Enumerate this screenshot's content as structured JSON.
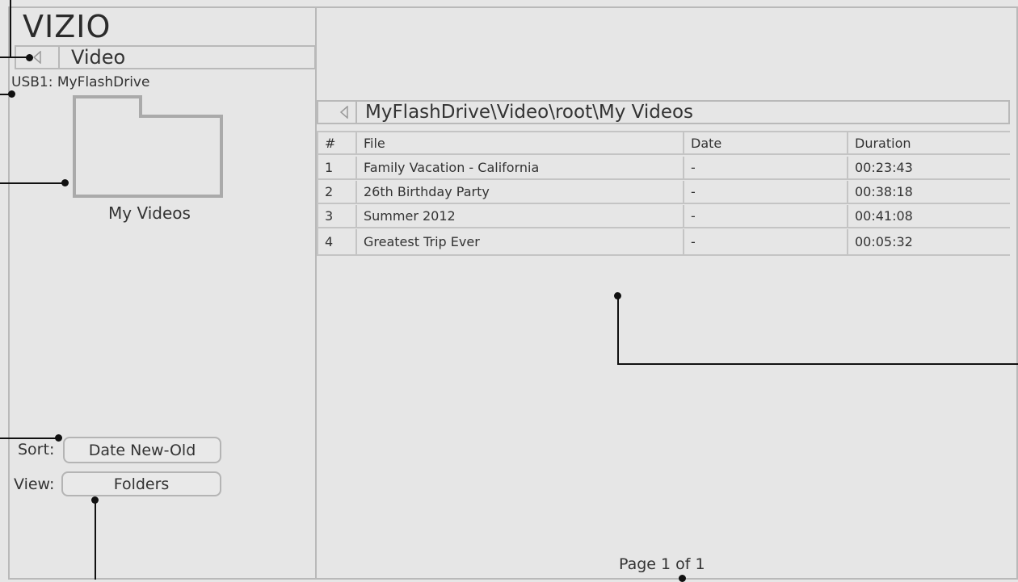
{
  "brand": {
    "logo_text": "VIZIO"
  },
  "sidebar": {
    "back_icon": "left-triangle-icon",
    "section_title": "Video",
    "source_label": "USB1: MyFlashDrive",
    "folder": {
      "icon": "folder-icon",
      "label": "My Videos"
    },
    "sort": {
      "label": "Sort:",
      "value": "Date New-Old"
    },
    "view": {
      "label": "View:",
      "value": "Folders"
    }
  },
  "main": {
    "back_icon": "left-triangle-icon",
    "path": "MyFlashDrive\\Video\\root\\My Videos",
    "table": {
      "headers": [
        "#",
        "File",
        "Date",
        "Duration"
      ],
      "rows": [
        [
          "1",
          "Family Vacation - California",
          "-",
          "00:23:43"
        ],
        [
          "2",
          "26th Birthday Party",
          "-",
          "00:38:18"
        ],
        [
          "3",
          "Summer 2012",
          "-",
          "00:41:08"
        ],
        [
          "4",
          "Greatest Trip Ever",
          "-",
          "00:05:32"
        ]
      ]
    },
    "pagination": "Page 1 of 1"
  },
  "colors": {
    "background": "#e6e6e6",
    "border": "#b9b9b9",
    "folder_outline": "#aaaaaa",
    "callout": "#111111"
  }
}
